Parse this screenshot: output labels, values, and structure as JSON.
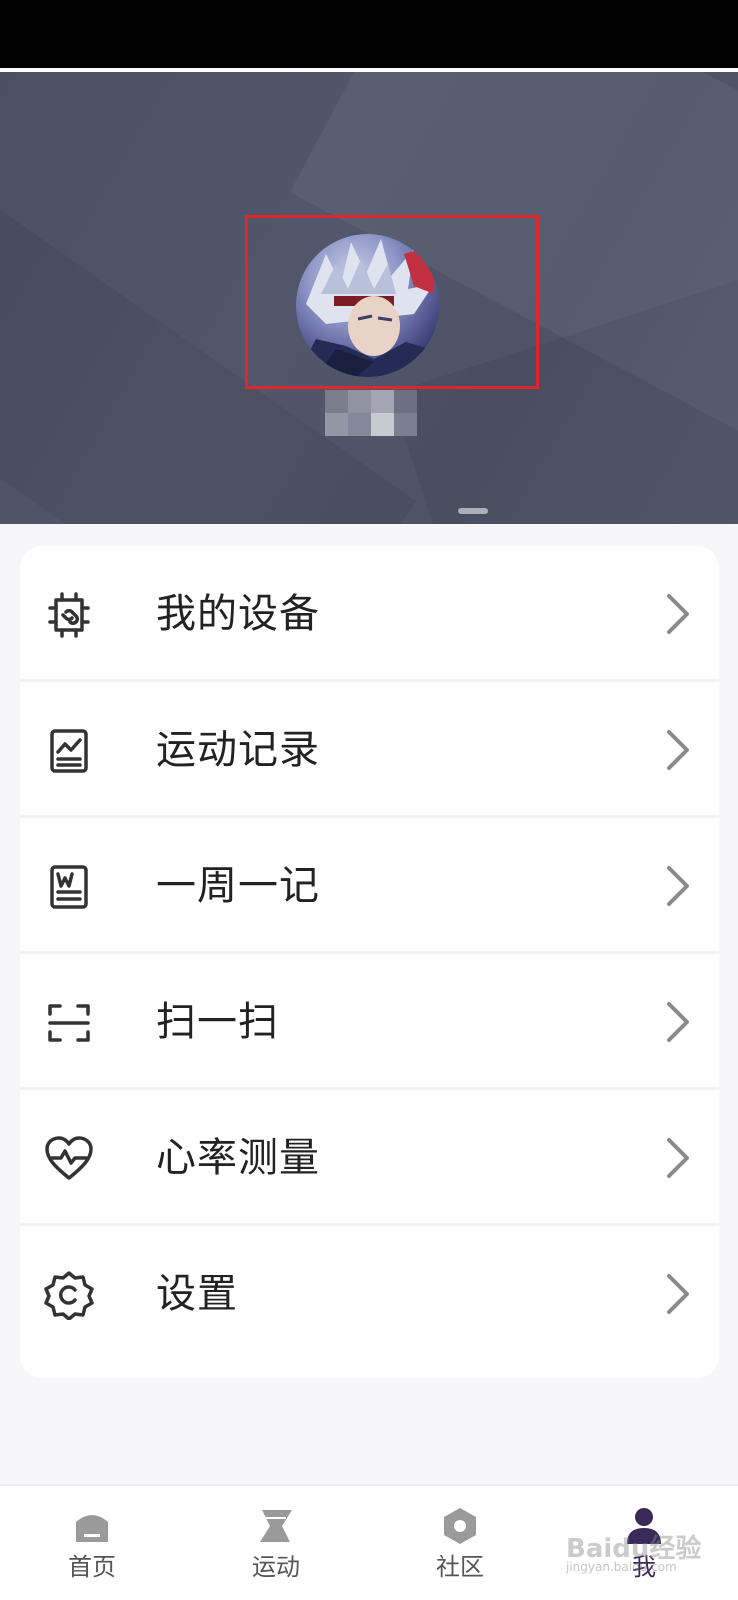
{
  "menu": {
    "items": [
      {
        "label": "我的设备",
        "icon": "device-link-icon"
      },
      {
        "label": "运动记录",
        "icon": "activity-chart-icon"
      },
      {
        "label": "一周一记",
        "icon": "weekly-note-icon"
      },
      {
        "label": "扫一扫",
        "icon": "scan-icon"
      },
      {
        "label": "心率测量",
        "icon": "heart-rate-icon"
      },
      {
        "label": "设置",
        "icon": "settings-gear-icon"
      }
    ]
  },
  "nav": {
    "items": [
      {
        "label": "首页",
        "icon": "home-icon"
      },
      {
        "label": "运动",
        "icon": "sport-icon"
      },
      {
        "label": "社区",
        "icon": "community-icon"
      },
      {
        "label": "我",
        "icon": "me-icon"
      }
    ],
    "active_index": 3
  },
  "watermark": {
    "text": "Baidu经验",
    "sub": "jingyan.baidu.com"
  },
  "colors": {
    "header_bg": "#4e5366",
    "highlight": "#e0262a",
    "active_nav": "#3a2a5a"
  }
}
